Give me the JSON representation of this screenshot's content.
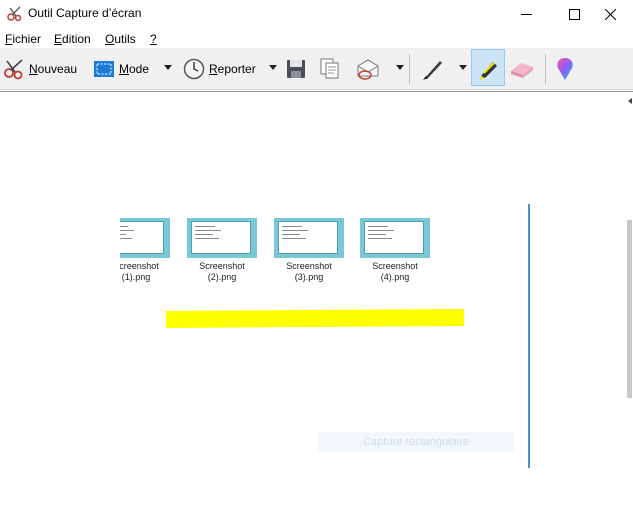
{
  "window": {
    "title": "Outil Capture d’écran",
    "icon": "snipping-tool-icon"
  },
  "menu": [
    {
      "first": "F",
      "rest": "ichier"
    },
    {
      "first": "E",
      "rest": "dition"
    },
    {
      "first": "O",
      "rest": "utils"
    },
    {
      "first": "?",
      "rest": ""
    }
  ],
  "toolbar": {
    "new": {
      "first": "N",
      "rest": "ouveau",
      "icon": "scissors-icon"
    },
    "mode": {
      "first": "M",
      "rest": "ode",
      "icon": "rectangle-snip-icon"
    },
    "delay": {
      "first": "R",
      "rest": "eporter",
      "icon": "clock-icon"
    },
    "save_icon": "save-icon",
    "copy_icon": "copy-icon",
    "send_icon": "send-email-icon",
    "pen_icon": "pen-icon",
    "highlighter_icon": "highlighter-icon",
    "eraser_icon": "eraser-icon",
    "paint3d_icon": "paint-3d-icon",
    "highlighter_selected": true
  },
  "capture": {
    "thumbnails": [
      {
        "line1": "Screenshot",
        "line2": "(1).png"
      },
      {
        "line1": "Screenshot",
        "line2": "(2).png"
      },
      {
        "line1": "Screenshot",
        "line2": "(3).png"
      },
      {
        "line1": "Screenshot",
        "line2": "(4).png"
      }
    ],
    "ghost_label": "Capture rectangulaire",
    "highlight_color": "#ffff00"
  },
  "colors": {
    "accent": "#4a8fc9",
    "toolbar_bg": "#f0f0f0",
    "pressed_bg": "#cce4f7",
    "thumbnail_bg": "#7ac8d6"
  }
}
